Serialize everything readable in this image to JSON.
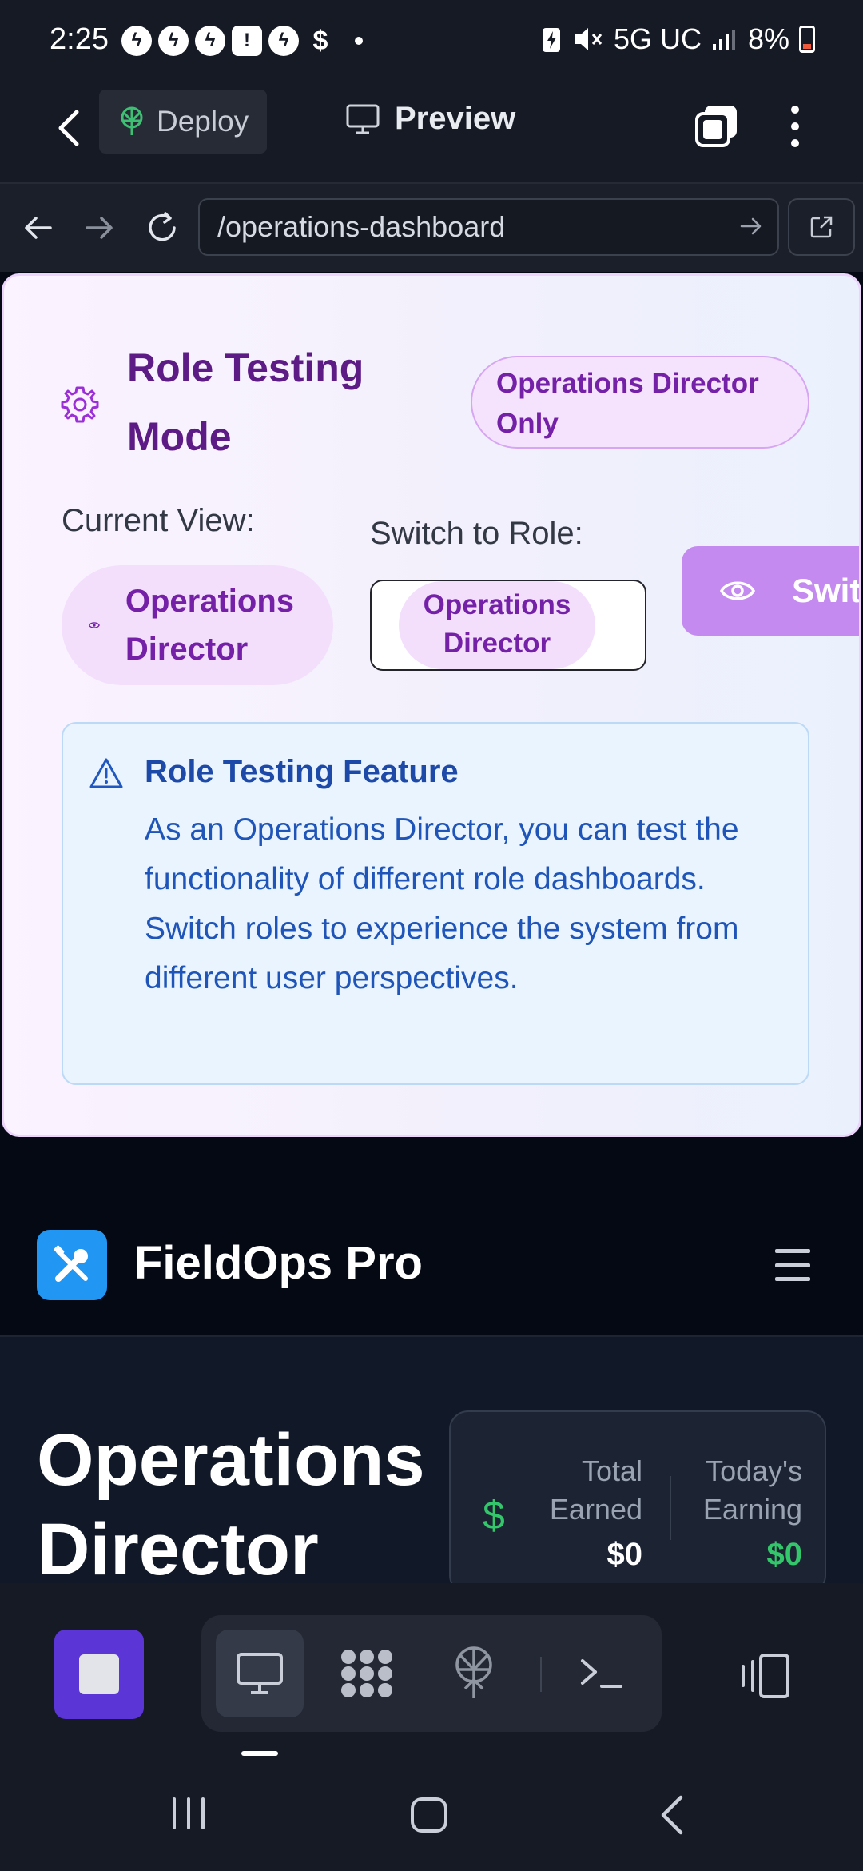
{
  "status_bar": {
    "time": "2:25",
    "network": "5G UC",
    "battery": "8%",
    "icons": [
      "messenger-icon",
      "messenger-icon",
      "messenger-icon",
      "alert-icon",
      "messenger-icon",
      "dollar-icon",
      "dot-icon",
      "battery-saver-icon",
      "mute-icon",
      "signal-icon",
      "battery-icon"
    ]
  },
  "toolbar": {
    "deploy_label": "Deploy",
    "preview_label": "Preview"
  },
  "browser": {
    "url": "/operations-dashboard"
  },
  "role_testing": {
    "title": "Role Testing Mode",
    "badge": "Operations Director Only",
    "current_view_label": "Current View:",
    "current_role": "Operations Director",
    "switch_label": "Switch to Role:",
    "selected_role": "Operations Director",
    "switch_button": "Switch",
    "info_title": "Role Testing Feature",
    "info_body": "As an Operations Director, you can test the functionality of different role dashboards. Switch roles to experience the system from different user perspectives."
  },
  "app": {
    "name": "FieldOps Pro",
    "heading": "Operations Director",
    "earnings": {
      "total_label": "Total Earned",
      "total_value": "$0",
      "today_label": "Today's Earning",
      "today_value": "$0"
    }
  },
  "colors": {
    "accent_purple": "#7421a8",
    "brand_blue": "#2196f3",
    "stop_button": "#5b35d5",
    "money_green": "#34c66a"
  }
}
